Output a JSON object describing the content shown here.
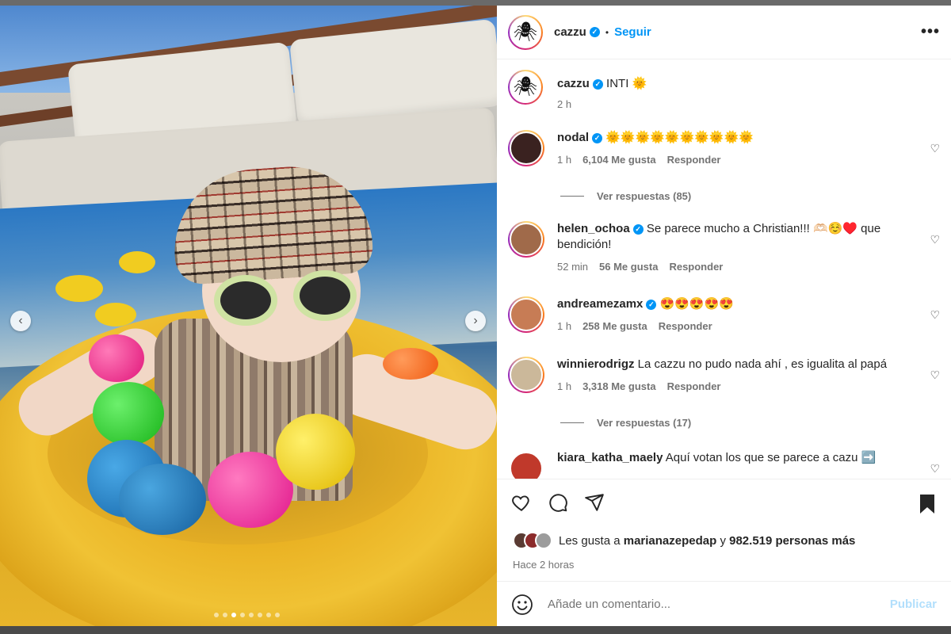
{
  "post": {
    "author": "cazzu",
    "follow_label": "Seguir",
    "separator": "•",
    "more_label": "•••",
    "caption_text": "INTI 🌞",
    "caption_time": "2 h",
    "carousel": {
      "total_slides": 8,
      "active_slide": 3,
      "prev_label": "‹",
      "next_label": "›"
    }
  },
  "comments": [
    {
      "user": "nodal",
      "text": "🌞🌞🌞🌞🌞🌞🌞🌞🌞🌞",
      "time": "1 h",
      "likes": "6,104 Me gusta",
      "reply": "Responder",
      "avatar_color": "#3a2220",
      "view_replies": "Ver respuestas (85)"
    },
    {
      "user": "helen_ochoa",
      "text": "Se parece mucho a Christian!!! 🫶🏻☺️♥️ que bendición!",
      "time": "52 min",
      "likes": "56 Me gusta",
      "reply": "Responder",
      "avatar_color": "#a06a4a"
    },
    {
      "user": "andreamezamx",
      "text": "😍😍😍😍😍",
      "time": "1 h",
      "likes": "258 Me gusta",
      "reply": "Responder",
      "avatar_color": "#c77c55"
    },
    {
      "user": "winnierodrigz",
      "text": "La cazzu no pudo nada ahí , es igualita al papá",
      "time": "1 h",
      "likes": "3,318 Me gusta",
      "reply": "Responder",
      "avatar_color": "#cbb89a",
      "view_replies": "Ver respuestas (17)"
    },
    {
      "user": "kiara_katha_maely",
      "text": "Aquí votan los que se parece a cazu ➡️",
      "avatar_color": "#c0392b"
    }
  ],
  "actions": {
    "likes_prefix": "Les gusta a",
    "likes_user": "marianazepedap",
    "likes_middle": "y",
    "likes_count": "982.519 personas más",
    "posted_time": "Hace 2 horas",
    "comment_placeholder": "Añade un comentario...",
    "publish_label": "Publicar"
  },
  "colors": {
    "accent": "#0095f6",
    "muted": "#737373",
    "publish_disabled": "#b2dffc"
  },
  "icons": [
    "spider-avatar-icon",
    "verified-badge-icon",
    "more-options-icon",
    "heart-icon",
    "comment-icon",
    "share-icon",
    "bookmark-icon",
    "emoji-icon",
    "chevron-left-icon",
    "chevron-right-icon"
  ]
}
